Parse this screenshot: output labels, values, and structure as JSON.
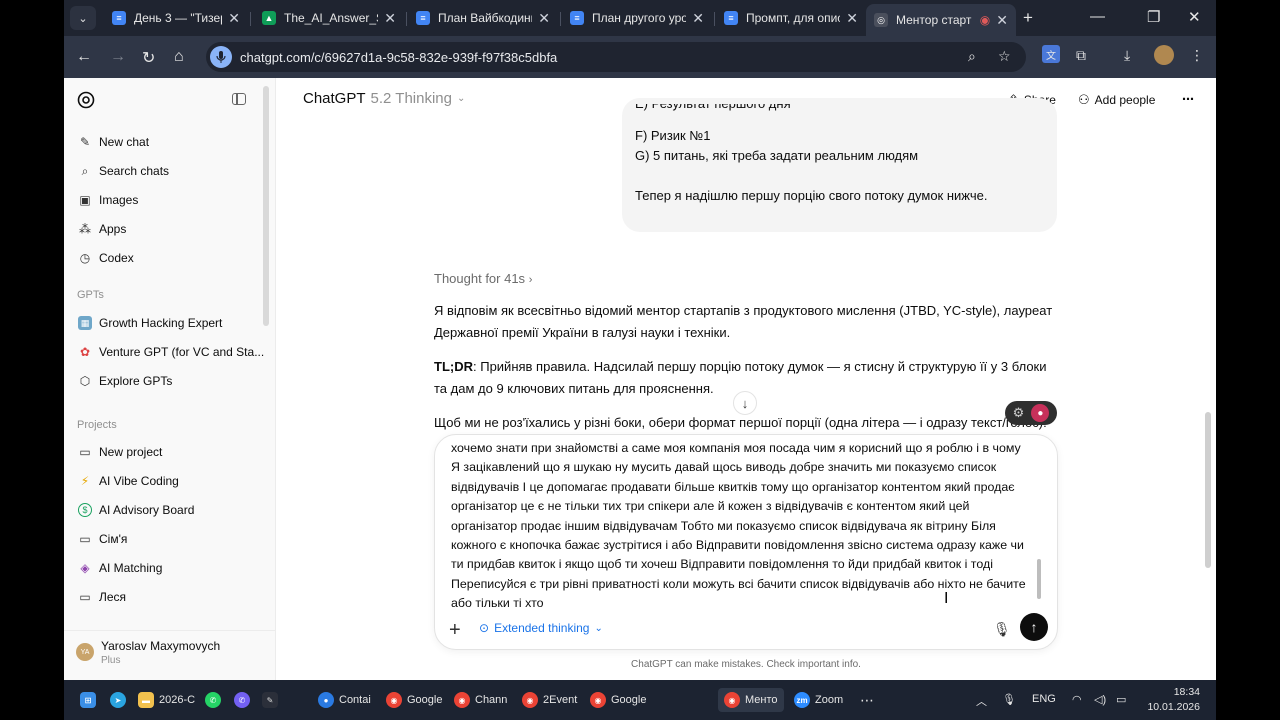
{
  "browser": {
    "tabs": [
      {
        "title": "День 3 — \"Тизер",
        "color": "#4285f4",
        "letter": "≡"
      },
      {
        "title": "The_AI_Answer_Str",
        "color": "#0f9d58",
        "letter": "▲"
      },
      {
        "title": "План Вайбкодинг",
        "color": "#4285f4",
        "letter": "≡"
      },
      {
        "title": "План другого уро",
        "color": "#4285f4",
        "letter": "≡"
      },
      {
        "title": "Промпт, для опис",
        "color": "#4285f4",
        "letter": "≡"
      },
      {
        "title": "Ментор старт",
        "color": "#4a4f5c",
        "letter": "◎"
      }
    ],
    "url": "chatgpt.com/c/69627d1a-9c58-832e-939f-f97f38c5dbfa"
  },
  "sidebar": {
    "items": [
      {
        "label": "New chat",
        "icon": "edit-icon",
        "glyph": "✎"
      },
      {
        "label": "Search chats",
        "icon": "search-icon",
        "glyph": "⌕"
      },
      {
        "label": "Images",
        "icon": "image-icon",
        "glyph": "▣"
      },
      {
        "label": "Apps",
        "icon": "apps-icon",
        "glyph": "⁂"
      },
      {
        "label": "Codex",
        "icon": "codex-icon",
        "glyph": "◷"
      }
    ],
    "gpts_title": "GPTs",
    "gpts": [
      {
        "label": "Growth Hacking Expert",
        "glyph": "▦"
      },
      {
        "label": "Venture GPT (for VC and Sta...",
        "glyph": "✿"
      },
      {
        "label": "Explore GPTs",
        "glyph": "⬡"
      }
    ],
    "projects_title": "Projects",
    "projects": [
      {
        "label": "New project",
        "glyph": "▭",
        "color": "#333333"
      },
      {
        "label": "AI Vibe Coding",
        "glyph": "⚡",
        "color": "#e6a700"
      },
      {
        "label": "AI Advisory Board",
        "glyph": "$",
        "color": "#1aa260"
      },
      {
        "label": "Сім'я",
        "glyph": "▭",
        "color": "#333333"
      },
      {
        "label": "AI Matching",
        "glyph": "◈",
        "color": "#8e44ad"
      },
      {
        "label": "Леся",
        "glyph": "▭",
        "color": "#333333"
      }
    ],
    "user": {
      "initials": "YA",
      "name": "Yaroslav Maxymovych",
      "plan": "Plus"
    }
  },
  "header": {
    "model": "ChatGPT",
    "version": "5.2 Thinking",
    "share": "Share",
    "add_people": "Add people"
  },
  "conversation": {
    "user_lines": [
      "E) Результат першого дня",
      "F) Ризик №1",
      "G) 5 питань, які треба задати реальним людям",
      "Тепер я надішлю першу порцію свого потоку думок нижче."
    ],
    "thought": "Thought for 41s",
    "answer_p1": "Я відповім як всесвітньо відомий ментор стартапів з продуктового мислення (JTBD, YC-style), лауреат Державної премії України в галузі науки і техніки.",
    "answer_p2_bold": "TL;DR",
    "answer_p2": ": Прийняв правила. Надсилай першу порцію потоку думок — я стисну й структурую її у 3 блоки та дам до 9 ключових питань для прояснення.",
    "answer_p3": "Щоб ми не роз'їхались у різні боки, обери формат першої порції (одна літера — і одразу текст/голос):"
  },
  "composer": {
    "text": "хочемо знати при знайомстві а саме моя компанія  моя посада чим я корисний що я роблю і в чому Я зацікавлений що я шукаю  ну мусить  давай щось виводь  добре  значить ми показуємо список відвідувачів  І це допомагає продавати більше квитків тому що організатор контентом який продає організатор це є не тільки тих три спікери але й кожен з відвідувачів є контентом який цей організатор продає іншим відвідувачам Тобто ми показуємо список відвідувача як вітрину Біля кожного є кнопочка бажає зустрітися і або Відправити повідомлення звісно система одразу каже чи ти придбав квиток і якщо щоб ти хочеш Відправити повідомлення то йди придбай квиток і тоді Переписуйся є три рівні приватності коли можуть всі бачити список відвідувачів або ніхто  не бачите або тільки ті хто",
    "mode": "Extended thinking"
  },
  "disclaimer": "ChatGPT can make mistakes. Check important info.",
  "taskbar": {
    "apps": [
      {
        "label": "2026-С",
        "color": "#f2c14e",
        "glyph": "▬"
      },
      {
        "label": "Contai",
        "color": "#2a7ae2",
        "glyph": "●"
      },
      {
        "label": "Google",
        "color": "#ea4335",
        "glyph": "◉"
      },
      {
        "label": "Chann",
        "color": "#ea4335",
        "glyph": "◉"
      },
      {
        "label": "2Event",
        "color": "#ea4335",
        "glyph": "◉"
      },
      {
        "label": "Google",
        "color": "#ea4335",
        "glyph": "◉"
      },
      {
        "label": "Менто",
        "color": "#ea4335",
        "glyph": "◉"
      },
      {
        "label": "Zoom",
        "color": "#2d8cff",
        "glyph": "zm"
      }
    ],
    "lang": "ENG",
    "time": "18:34",
    "date": "10.01.2026"
  }
}
